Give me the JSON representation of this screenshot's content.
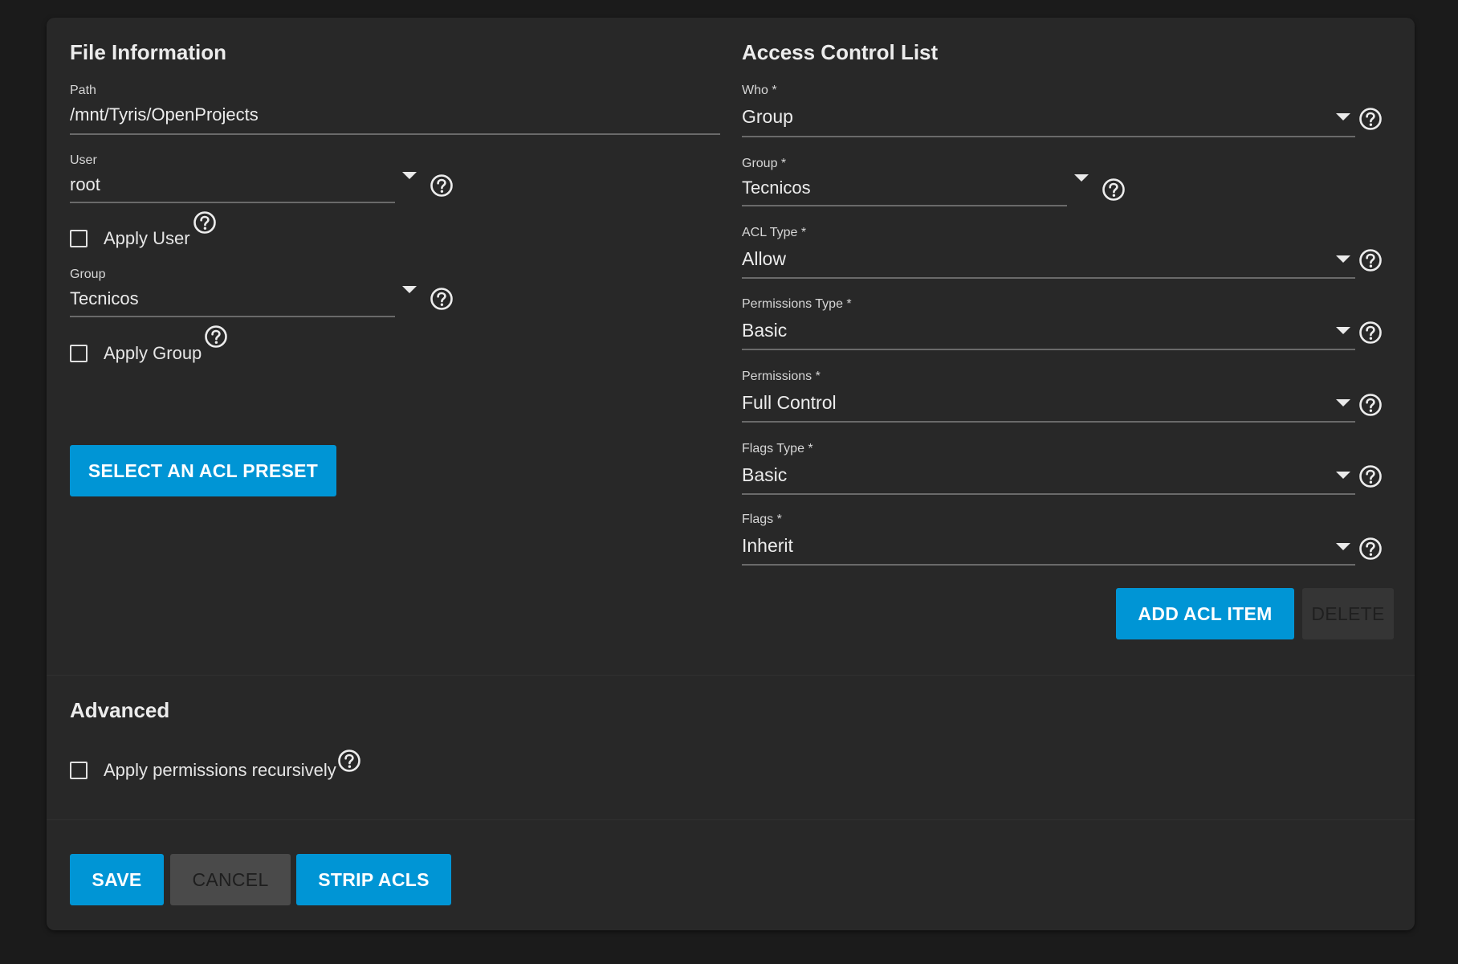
{
  "file_info": {
    "title": "File Information",
    "path": {
      "label": "Path",
      "value": "/mnt/Tyris/OpenProjects"
    },
    "user": {
      "label": "User",
      "value": "root",
      "apply_label": "Apply User"
    },
    "group": {
      "label": "Group",
      "value": "Tecnicos",
      "apply_label": "Apply Group"
    },
    "preset_button": "SELECT AN ACL PRESET"
  },
  "acl": {
    "title": "Access Control List",
    "who": {
      "label": "Who *",
      "value": "Group"
    },
    "group": {
      "label": "Group *",
      "value": "Tecnicos"
    },
    "acl_type": {
      "label": "ACL Type *",
      "value": "Allow"
    },
    "permissions_type": {
      "label": "Permissions Type *",
      "value": "Basic"
    },
    "permissions": {
      "label": "Permissions *",
      "value": "Full Control"
    },
    "flags_type": {
      "label": "Flags Type *",
      "value": "Basic"
    },
    "flags": {
      "label": "Flags *",
      "value": "Inherit"
    },
    "add_button": "ADD ACL ITEM",
    "delete_button": "DELETE"
  },
  "advanced": {
    "title": "Advanced",
    "recursive_label": "Apply permissions recursively"
  },
  "actions": {
    "save": "SAVE",
    "cancel": "CANCEL",
    "strip": "STRIP ACLS"
  },
  "colors": {
    "accent": "#0095d5",
    "card": "#282828",
    "background": "#1b1b1b"
  }
}
